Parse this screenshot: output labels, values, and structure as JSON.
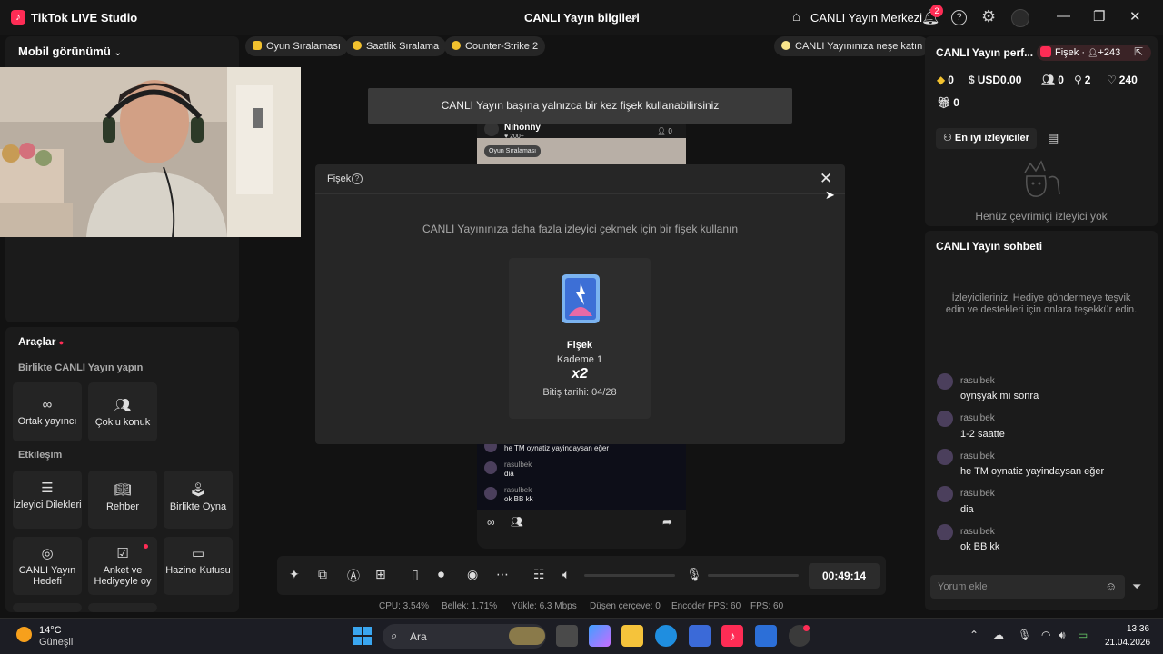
{
  "titlebar": {
    "app_name": "TikTok LIVE Studio",
    "center_title": "CANLI Yayın bilgileri",
    "live_center": "CANLI Yayın Merkezi",
    "notification_count": "2"
  },
  "left": {
    "mobile_view": "Mobil görünümü",
    "tools_title": "Araçlar",
    "collab_section": "Birlikte CANLI Yayın yapın",
    "collab_tiles": [
      "Ortak yayıncı",
      "Çoklu konuk"
    ],
    "engage_section": "Etkileşim",
    "engage_tiles": [
      "İzleyici Dilekleri",
      "Rehber",
      "Birlikte Oyna",
      "CANLI Yayın Hedefi",
      "Anket ve Hediyeyle oy",
      "Hazine Kutusu"
    ]
  },
  "chips": {
    "game_rank": "Oyun Sıralaması",
    "hourly_rank": "Saatlik Sıralama",
    "game": "Counter-Strike 2",
    "cheer": "CANLI Yayınınıza neşe katın"
  },
  "stage": {
    "toast": "CANLI Yayın başına yalnızca bir kez fişek kullanabilirsiniz",
    "preview_user": "Nihonny",
    "preview_likes": "200+",
    "preview_viewers": "0",
    "preview_chip": "Oyun Sıralaması",
    "preview_chat": [
      {
        "name": "",
        "msg": "he TM oynatiz yayindaysan eğer"
      },
      {
        "name": "rasulbek",
        "msg": "dia"
      },
      {
        "name": "rasulbek",
        "msg": "ok BB kk"
      }
    ]
  },
  "modal": {
    "title": "Fişek",
    "description": "CANLI Yayınınıza daha fazla izleyici çekmek için bir fişek kullanın",
    "card_name": "Fişek",
    "card_level": "Kademe 1",
    "card_multiplier": "x2",
    "card_expiry": "Bitiş tarihi: 04/28"
  },
  "toolbar": {
    "timer": "00:49:14"
  },
  "stats": {
    "cpu": "CPU:  3.54%",
    "memory": "Bellek:  1.71%",
    "upload": "Yükle:  6.3 Mbps",
    "dropped": "Düşen çerçeve:  0",
    "encoder_fps": "Encoder FPS:  60",
    "fps": "FPS:  60"
  },
  "right": {
    "perf_title": "CANLI Yayın perf...",
    "fisek_badge": "Fişek · ",
    "fisek_count": "+243",
    "metrics": {
      "diamonds": "0",
      "usd": "USD0.00",
      "viewers": "0",
      "followers": "2",
      "likes": "240",
      "gifts": "0"
    },
    "top_viewers_btn": "En iyi izleyiciler",
    "no_viewers": "Henüz çevrimiçi izleyici yok",
    "chat_title": "CANLI Yayın sohbeti",
    "chat_hint": "İzleyicilerinizi Hediye göndermeye teşvik edin ve destekleri için onlara teşekkür edin.",
    "messages": [
      {
        "name": "rasulbek",
        "msg": "oynşyak mı sonra"
      },
      {
        "name": "rasulbek",
        "msg": "1-2 saatte"
      },
      {
        "name": "rasulbek",
        "msg": "he TM oynatiz yayindaysan eğer"
      },
      {
        "name": "rasulbek",
        "msg": "dia"
      },
      {
        "name": "rasulbek",
        "msg": "ok BB kk"
      }
    ],
    "comment_placeholder": "Yorum ekle"
  },
  "taskbar": {
    "temp": "14°C",
    "weather": "Güneşli",
    "search": "Ara",
    "time": "13:36",
    "date": "21.04.2026"
  }
}
